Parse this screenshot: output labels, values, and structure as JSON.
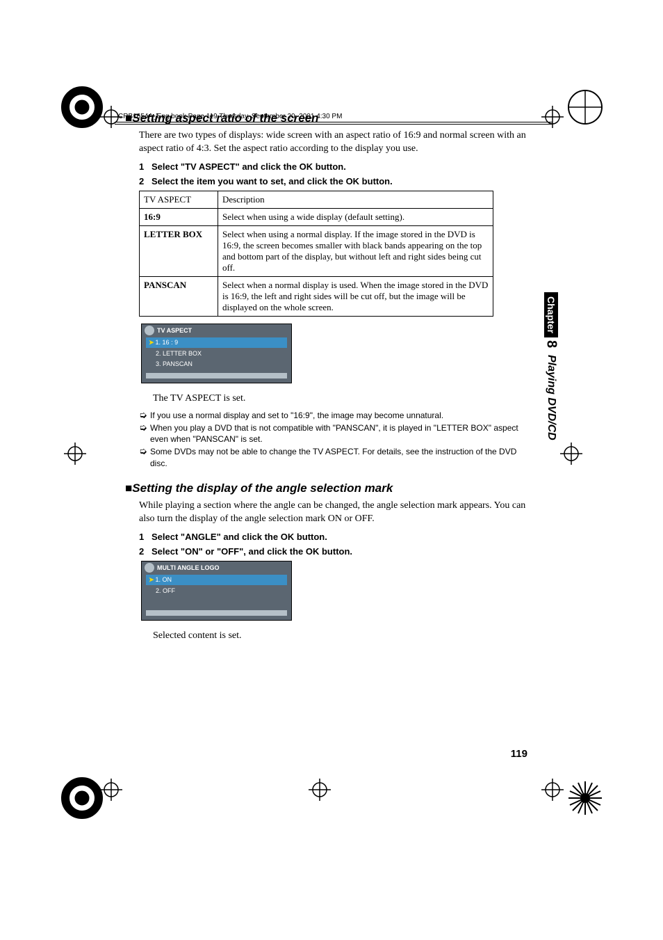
{
  "scanline": "CRB1654A_Eng.book  Page 119  Thursday, September 20, 2001  4:30 PM",
  "side": {
    "chapter_label": "Chapter",
    "chapter_num": "8",
    "title": "Playing DVD/CD"
  },
  "page_number": "119",
  "s1": {
    "heading": "Setting aspect ratio of the screen",
    "intro": "There are two types of displays: wide screen with an aspect ratio of 16:9 and normal screen with an aspect ratio of 4:3. Set the aspect ratio according to the display you use.",
    "step1": "Select \"TV ASPECT\" and click the OK button.",
    "step2": "Select the item you want to set, and click the OK button.",
    "table": {
      "h1": "TV ASPECT",
      "h2": "Description",
      "r1c1": "16:9",
      "r1c2": "Select when using a wide display (default setting).",
      "r2c1": "LETTER BOX",
      "r2c2": "Select when using a normal display. If the image stored in the DVD is 16:9, the screen becomes smaller with black bands appearing on the top and bottom part of the display, but without left and right sides being cut off.",
      "r3c1": "PANSCAN",
      "r3c2": "Select when a normal display is used. When the image stored in the DVD is 16:9, the left and right sides will be cut off, but the image will be displayed on the whole screen."
    },
    "osd": {
      "title": "TV ASPECT",
      "opt1": "1. 16 : 9",
      "opt2": "2. LETTER BOX",
      "opt3": "3. PANSCAN"
    },
    "caption": "The TV ASPECT is set.",
    "notes": {
      "n1": "If you use a normal display and set to \"16:9\", the image may become unnatural.",
      "n2": "When you play a DVD that is not compatible with \"PANSCAN\", it is played in \"LETTER BOX\" aspect even when \"PANSCAN\" is set.",
      "n3": "Some DVDs may not be able to change the TV ASPECT. For details, see the instruction of the DVD disc."
    }
  },
  "s2": {
    "heading": "Setting the display of the angle selection mark",
    "intro": "While playing a section where the angle can be changed, the angle selection mark appears. You can also turn the display of the angle selection mark ON or OFF.",
    "step1": "Select \"ANGLE\" and click the OK button.",
    "step2": "Select \"ON\" or \"OFF\", and click the OK button.",
    "osd": {
      "title": "MULTI ANGLE LOGO",
      "opt1": "1. ON",
      "opt2": "2. OFF"
    },
    "caption": "Selected content is set."
  }
}
